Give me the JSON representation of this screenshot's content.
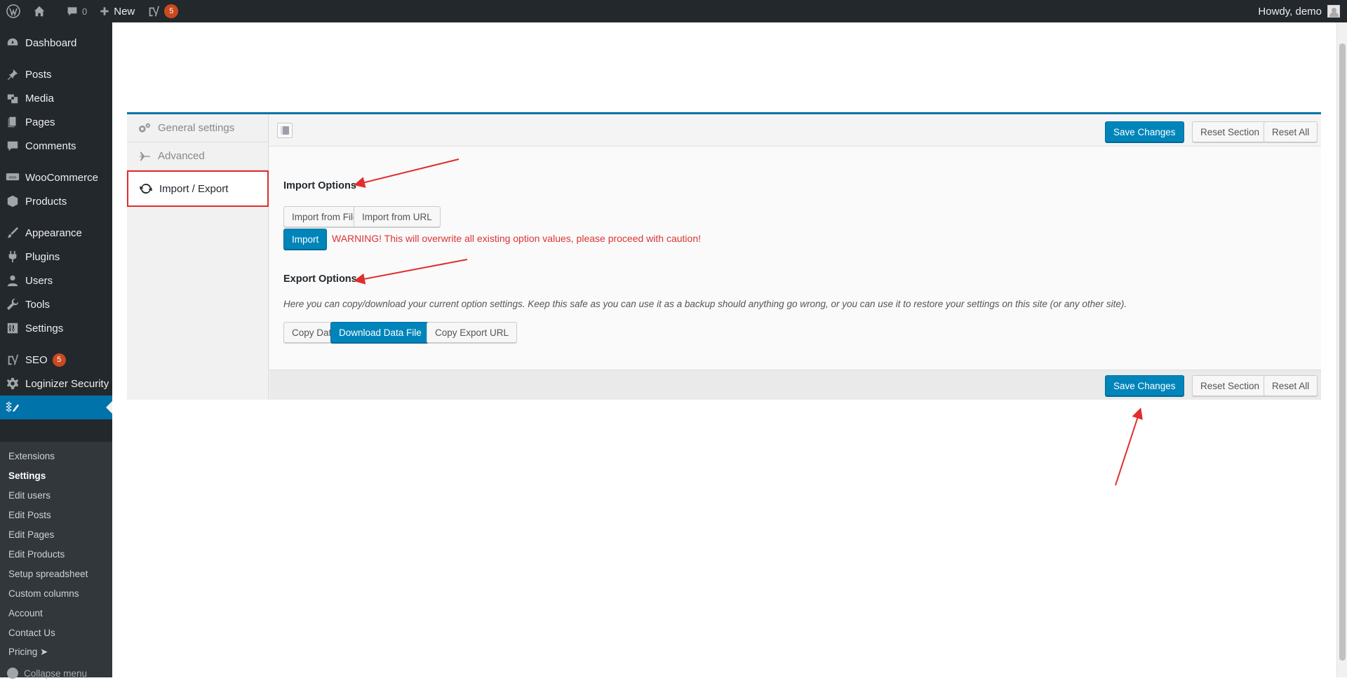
{
  "admin_bar": {
    "comments_count": "0",
    "new_label": "New",
    "yoast_badge": "5",
    "greeting": "Howdy, demo"
  },
  "sidebar": {
    "items": [
      {
        "label": "Dashboard",
        "icon": "dashboard-icon"
      },
      {
        "label": "Posts",
        "icon": "pin-icon"
      },
      {
        "label": "Media",
        "icon": "media-icon"
      },
      {
        "label": "Pages",
        "icon": "pages-icon"
      },
      {
        "label": "Comments",
        "icon": "comment-icon"
      },
      {
        "label": "WooCommerce",
        "icon": "woo-icon"
      },
      {
        "label": "Products",
        "icon": "box-icon"
      },
      {
        "label": "Appearance",
        "icon": "brush-icon"
      },
      {
        "label": "Plugins",
        "icon": "plug-icon"
      },
      {
        "label": "Users",
        "icon": "user-icon"
      },
      {
        "label": "Tools",
        "icon": "wrench-icon"
      },
      {
        "label": "Settings",
        "icon": "sliders-icon"
      },
      {
        "label": "SEO",
        "icon": "yoast-icon",
        "badge": "5"
      },
      {
        "label": "Loginizer Security",
        "icon": "gear-icon"
      }
    ],
    "submenu": [
      "Extensions",
      "Settings",
      "Edit users",
      "Edit Posts",
      "Edit Pages",
      "Edit Products",
      "Setup spreadsheet",
      "Custom columns",
      "Account",
      "Contact Us",
      "Pricing ➤"
    ],
    "collapse_label": "Collapse menu"
  },
  "panel": {
    "tabs": [
      {
        "label": "General settings",
        "icon": "gears-icon"
      },
      {
        "label": "Advanced",
        "icon": "airplane-icon"
      },
      {
        "label": "Import / Export",
        "icon": "refresh-icon"
      }
    ],
    "buttons": {
      "save": "Save Changes",
      "reset_section": "Reset Section",
      "reset_all": "Reset All"
    },
    "import": {
      "title": "Import Options",
      "from_file": "Import from File",
      "from_url": "Import from URL",
      "import_btn": "Import",
      "warning": "WARNING! This will overwrite all existing option values, please proceed with caution!"
    },
    "export": {
      "title": "Export Options",
      "description": "Here you can copy/download your current option settings. Keep this safe as you can use it as a backup should anything go wrong, or you can use it to restore your settings on this site (or any other site).",
      "copy_data": "Copy Data",
      "download": "Download Data File",
      "copy_url": "Copy Export URL"
    }
  },
  "colors": {
    "admin_dark": "#23282d",
    "primary_blue": "#0085ba",
    "highlight_red": "#e12d2d",
    "warning_red": "#dd3333"
  }
}
